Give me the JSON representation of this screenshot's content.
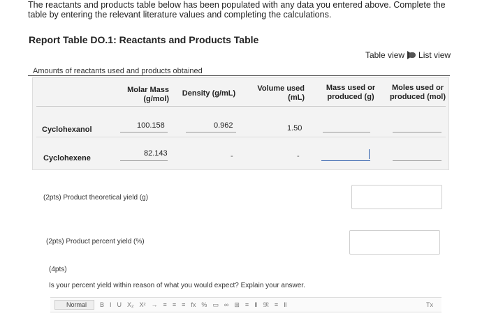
{
  "intro_text": "The reactants and products table below has been populated with any data you entered above. Complete the table by entering the relevant literature values and completing the calculations.",
  "report": {
    "title": "Report Table DO.1: Reactants and Products Table",
    "view_toggle": {
      "table_view": "Table view",
      "list_view": "List view"
    }
  },
  "table": {
    "caption": "Amounts of reactants used and products obtained",
    "headers": {
      "molar_mass": "Molar Mass (g/mol)",
      "density": "Density (g/mL)",
      "volume": "Volume used (mL)",
      "mass": "Mass used or produced (g)",
      "moles": "Moles used or produced (mol)"
    },
    "rows": [
      {
        "name": "Cyclohexanol",
        "molar_mass": "100.158",
        "density": "0.962",
        "volume": "1.50"
      },
      {
        "name": "Cyclohexene",
        "molar_mass": "82.143",
        "density": "-",
        "volume": "-"
      }
    ]
  },
  "questions": {
    "theoretical_yield": "(2pts) Product theoretical yield (g)",
    "percent_yield": "(2pts) Product percent yield (%)",
    "q3_points": "(4pts)",
    "q3_text": "Is your percent yield within reason of what you would expect? Explain your answer."
  },
  "editor": {
    "style_select": "Normal",
    "buttons": [
      "B",
      "I",
      "U",
      "X₂",
      "X²",
      "→",
      "≡",
      "≡",
      "≡",
      "fx",
      "%",
      "▭",
      "∞",
      "⊞",
      "≡",
      "Ⅱ",
      "𝔐",
      "≡",
      "Ⅱ",
      "Tx"
    ]
  }
}
